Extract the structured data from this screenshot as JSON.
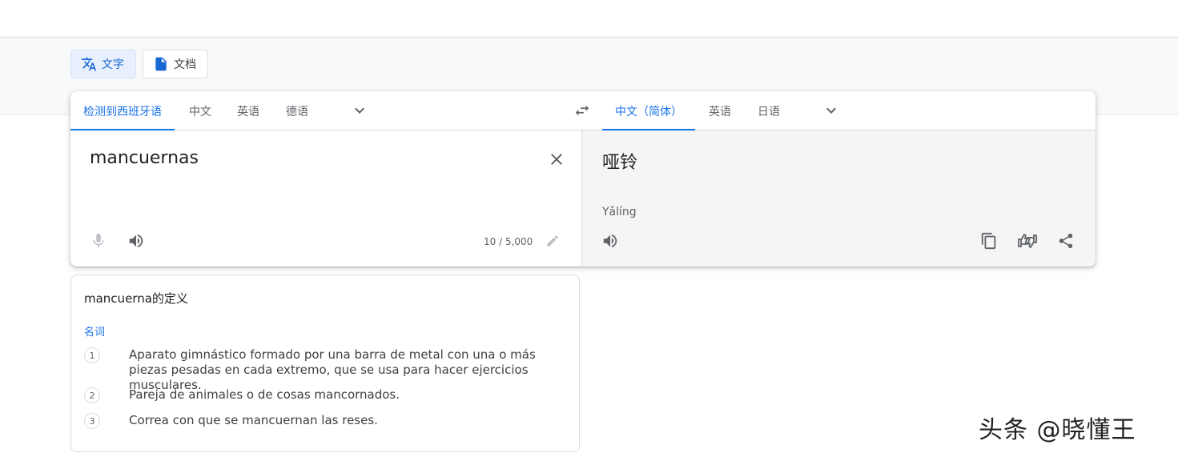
{
  "modes": {
    "text_label": "文字",
    "document_label": "文档"
  },
  "source_languages": {
    "detected": "检测到西班牙语",
    "items": [
      "中文",
      "英语",
      "德语"
    ]
  },
  "target_languages": {
    "selected": "中文（简体）",
    "items": [
      "英语",
      "日语"
    ]
  },
  "source": {
    "text": "mancuernas",
    "char_count": "10 / 5,000"
  },
  "target": {
    "text": "哑铃",
    "romanization": "Yǎlíng"
  },
  "definitions": {
    "title": "mancuerna的定义",
    "part_of_speech": "名词",
    "items": [
      {
        "num": "1",
        "text": "Aparato gimnástico formado por una barra de metal con una o más piezas pesadas en cada extremo, que se usa para hacer ejercicios musculares."
      },
      {
        "num": "2",
        "text": "Pareja de animales o de cosas mancornados."
      },
      {
        "num": "3",
        "text": "Correa con que se mancuernan las reses."
      }
    ]
  },
  "watermark": "头条 @晓懂王",
  "colors": {
    "accent": "#1a73e8",
    "icon": "#5f6368"
  }
}
